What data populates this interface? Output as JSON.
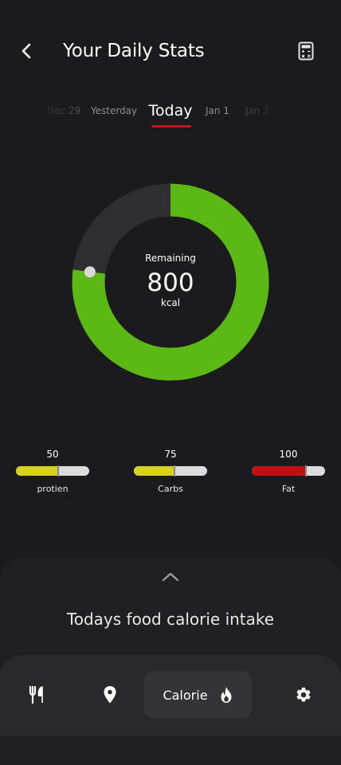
{
  "header": {
    "title": "Your Daily Stats",
    "back_icon": "back-arrow-icon",
    "calculator_icon": "calculator-icon"
  },
  "date_tabs": [
    {
      "label": "Dec 29",
      "state": "far"
    },
    {
      "label": "Yesterday",
      "state": "near"
    },
    {
      "label": "Today",
      "state": "active"
    },
    {
      "label": "Jan 1",
      "state": "near"
    },
    {
      "label": "Jan 2",
      "state": "far"
    }
  ],
  "calorie_ring": {
    "label": "Remaining",
    "value": "800",
    "unit": "kcal",
    "progress_fraction": 0.77,
    "colors": {
      "progress": "#5cb815",
      "track": "#2e2e33",
      "knob": "#d9d9dc"
    }
  },
  "macros": [
    {
      "value": "50",
      "name": "protien",
      "fill_fraction": 0.58,
      "color": "#d7d21e"
    },
    {
      "value": "75",
      "name": "Carbs",
      "fill_fraction": 0.55,
      "color": "#d7d21e"
    },
    {
      "value": "100",
      "name": "Fat",
      "fill_fraction": 0.74,
      "color": "#c20f12"
    }
  ],
  "sheet": {
    "title": "Todays food calorie intake",
    "expand_icon": "chevron-up-icon"
  },
  "bottom_nav": {
    "items": [
      {
        "icon": "fork-knife-icon",
        "active": false
      },
      {
        "icon": "location-pin-icon",
        "active": false
      },
      {
        "label": "Calorie",
        "icon": "flame-icon",
        "active": true
      },
      {
        "icon": "gear-icon",
        "active": false
      }
    ]
  },
  "colors": {
    "background": "#1b1b1d",
    "accent_red": "#c2161a",
    "accent_green": "#5cb815"
  }
}
